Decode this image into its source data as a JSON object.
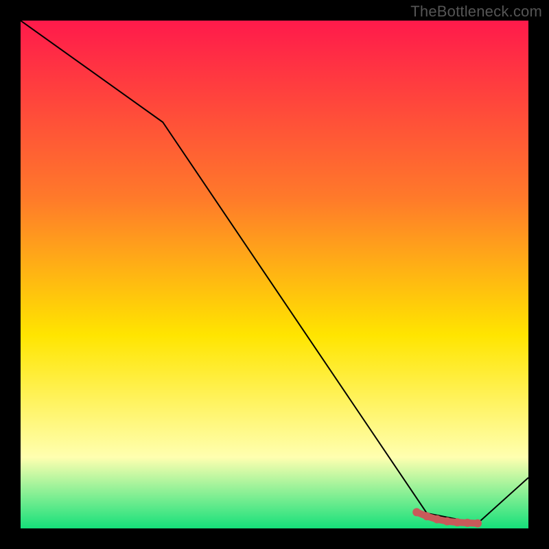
{
  "watermark": "TheBottleneck.com",
  "colors": {
    "gradient_top": "#ff1a4b",
    "gradient_mid_upper": "#ff7a2a",
    "gradient_mid": "#ffe500",
    "gradient_low": "#ffffb0",
    "gradient_bottom": "#15e07a",
    "line": "#000000",
    "marker": "#c85a5a",
    "frame": "#000000"
  },
  "chart_data": {
    "type": "line",
    "title": "",
    "xlabel": "",
    "ylabel": "",
    "xlim": [
      0,
      100
    ],
    "ylim": [
      0,
      100
    ],
    "series": [
      {
        "name": "curve",
        "x": [
          0,
          28,
          80,
          90,
          100
        ],
        "values": [
          100,
          80,
          3,
          1,
          10
        ]
      }
    ],
    "markers": {
      "name": "highlight",
      "x": [
        78,
        80,
        82,
        84,
        86,
        88,
        90
      ],
      "values": [
        3.2,
        2.4,
        1.8,
        1.4,
        1.2,
        1.1,
        1.0
      ]
    }
  }
}
